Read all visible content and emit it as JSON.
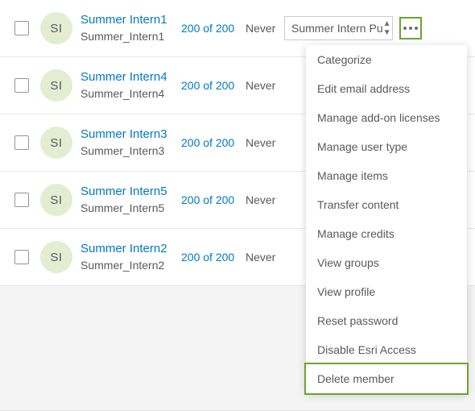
{
  "members": [
    {
      "initials": "SI",
      "display_name": "Summer Intern1",
      "username": "Summer_Intern1",
      "credits": "200 of 200",
      "last_login": "Never",
      "role": "Summer Intern Pu",
      "highlight_more": true
    },
    {
      "initials": "SI",
      "display_name": "Summer Intern4",
      "username": "Summer_Intern4",
      "credits": "200 of 200",
      "last_login": "Never",
      "role": "",
      "highlight_more": false
    },
    {
      "initials": "SI",
      "display_name": "Summer Intern3",
      "username": "Summer_Intern3",
      "credits": "200 of 200",
      "last_login": "Never",
      "role": "",
      "highlight_more": false
    },
    {
      "initials": "SI",
      "display_name": "Summer Intern5",
      "username": "Summer_Intern5",
      "credits": "200 of 200",
      "last_login": "Never",
      "role": "",
      "highlight_more": false
    },
    {
      "initials": "SI",
      "display_name": "Summer Intern2",
      "username": "Summer_Intern2",
      "credits": "200 of 200",
      "last_login": "Never",
      "role": "",
      "highlight_more": false
    }
  ],
  "menu": {
    "items": [
      {
        "label": "Categorize"
      },
      {
        "label": "Edit email address"
      },
      {
        "label": "Manage add-on licenses"
      },
      {
        "label": "Manage user type"
      },
      {
        "label": "Manage items"
      },
      {
        "label": "Transfer content"
      },
      {
        "label": "Manage credits"
      },
      {
        "label": "View groups"
      },
      {
        "label": "View profile"
      },
      {
        "label": "Reset password"
      },
      {
        "label": "Disable Esri Access"
      },
      {
        "label": "Delete member",
        "highlighted": true
      }
    ]
  },
  "colors": {
    "link": "#0079c1",
    "highlight": "#6aa52f",
    "avatar_bg": "#e3edd2"
  }
}
